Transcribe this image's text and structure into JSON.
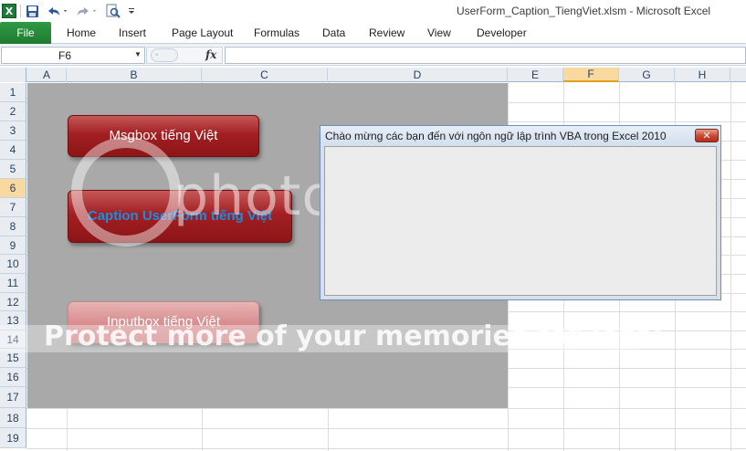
{
  "window": {
    "title": "UserForm_Caption_TiengViet.xlsm  -  Microsoft Excel",
    "logo_glyph": "X",
    "qat_icons": [
      "save-icon",
      "undo-icon",
      "redo-icon",
      "print-preview-icon",
      "customize-qat-icon"
    ]
  },
  "ribbon": {
    "file_label": "File",
    "tabs": [
      "Home",
      "Insert",
      "Page Layout",
      "Formulas",
      "Data",
      "Review",
      "View",
      "Developer"
    ]
  },
  "formula_bar": {
    "name_box": "F6",
    "fx_label": "fx",
    "content": ""
  },
  "sheet": {
    "columns": [
      "A",
      "B",
      "C",
      "D",
      "E",
      "F",
      "G",
      "H"
    ],
    "rows": [
      "1",
      "2",
      "3",
      "4",
      "5",
      "6",
      "7",
      "8",
      "9",
      "10",
      "11",
      "12",
      "13",
      "14",
      "15",
      "16",
      "17",
      "18",
      "19"
    ],
    "active_column": "F",
    "active_row": "6",
    "buttons": {
      "msgbox": "Msgbox tiếng Việt",
      "caption": "Caption UserForm tiếng Việt",
      "inputbox": "Inputbox tiếng Việt"
    }
  },
  "userform": {
    "caption": "Chào mừng các bạn đến với ngôn ngữ lập trình VBA trong Excel 2010",
    "close_glyph": "✕"
  },
  "watermark": {
    "brand": "photobucket",
    "banner": "Protect more of your memories for less!"
  },
  "colors": {
    "file_tab": "#2f9a44",
    "button_red": "#a21f22",
    "caption_text": "#1a8ee0",
    "active_header": "#f9d99f"
  }
}
